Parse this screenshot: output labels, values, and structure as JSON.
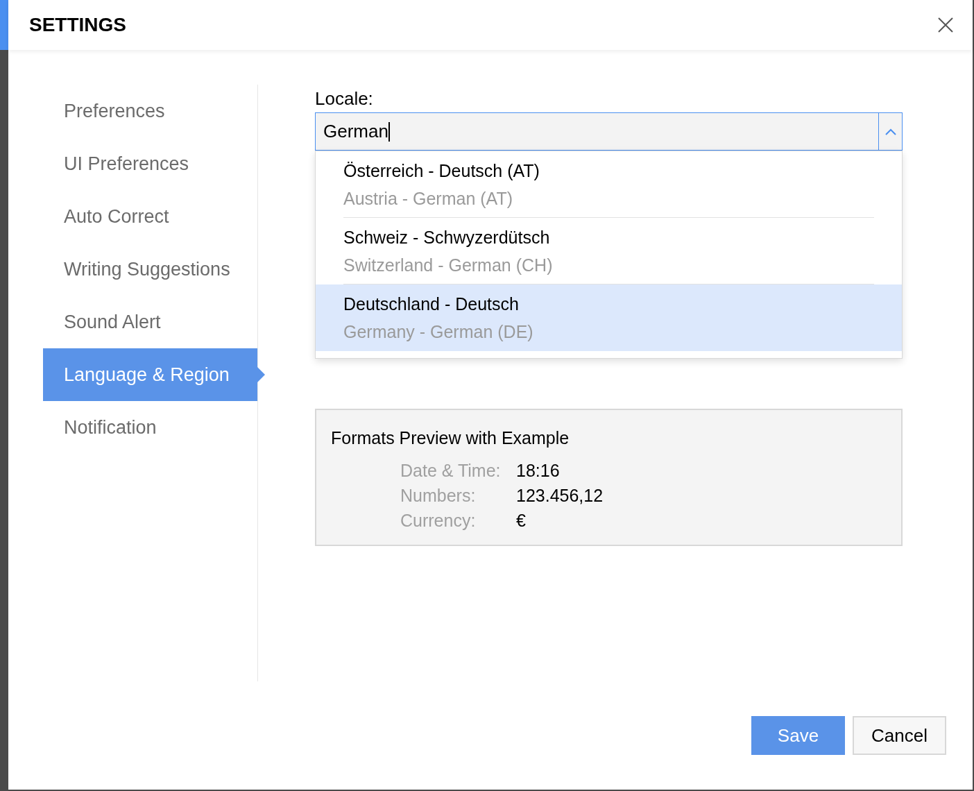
{
  "dialog": {
    "title": "SETTINGS"
  },
  "sidebar": {
    "items": [
      {
        "label": "Preferences",
        "selected": false
      },
      {
        "label": "UI Preferences",
        "selected": false
      },
      {
        "label": "Auto Correct",
        "selected": false
      },
      {
        "label": "Writing Suggestions",
        "selected": false
      },
      {
        "label": "Sound Alert",
        "selected": false
      },
      {
        "label": "Language & Region",
        "selected": true
      },
      {
        "label": "Notification",
        "selected": false
      }
    ]
  },
  "locale": {
    "label": "Locale:",
    "value": "German",
    "expanded": true,
    "options": [
      {
        "primary": "Österreich - Deutsch (AT)",
        "secondary": "Austria - German (AT)",
        "selected": false
      },
      {
        "primary": "Schweiz - Schwyzerdütsch",
        "secondary": "Switzerland - German (CH)",
        "selected": false
      },
      {
        "primary": "Deutschland - Deutsch",
        "secondary": "Germany - German (DE)",
        "selected": true
      }
    ]
  },
  "preview": {
    "title": "Formats Preview with Example",
    "rows": [
      {
        "label": "Date & Time:",
        "value": "18:16"
      },
      {
        "label": "Numbers:",
        "value": "123.456,12"
      },
      {
        "label": "Currency:",
        "value": "€"
      }
    ]
  },
  "buttons": [
    {
      "label": "Save",
      "kind": "primary"
    },
    {
      "label": "Cancel",
      "kind": "secondary"
    }
  ]
}
